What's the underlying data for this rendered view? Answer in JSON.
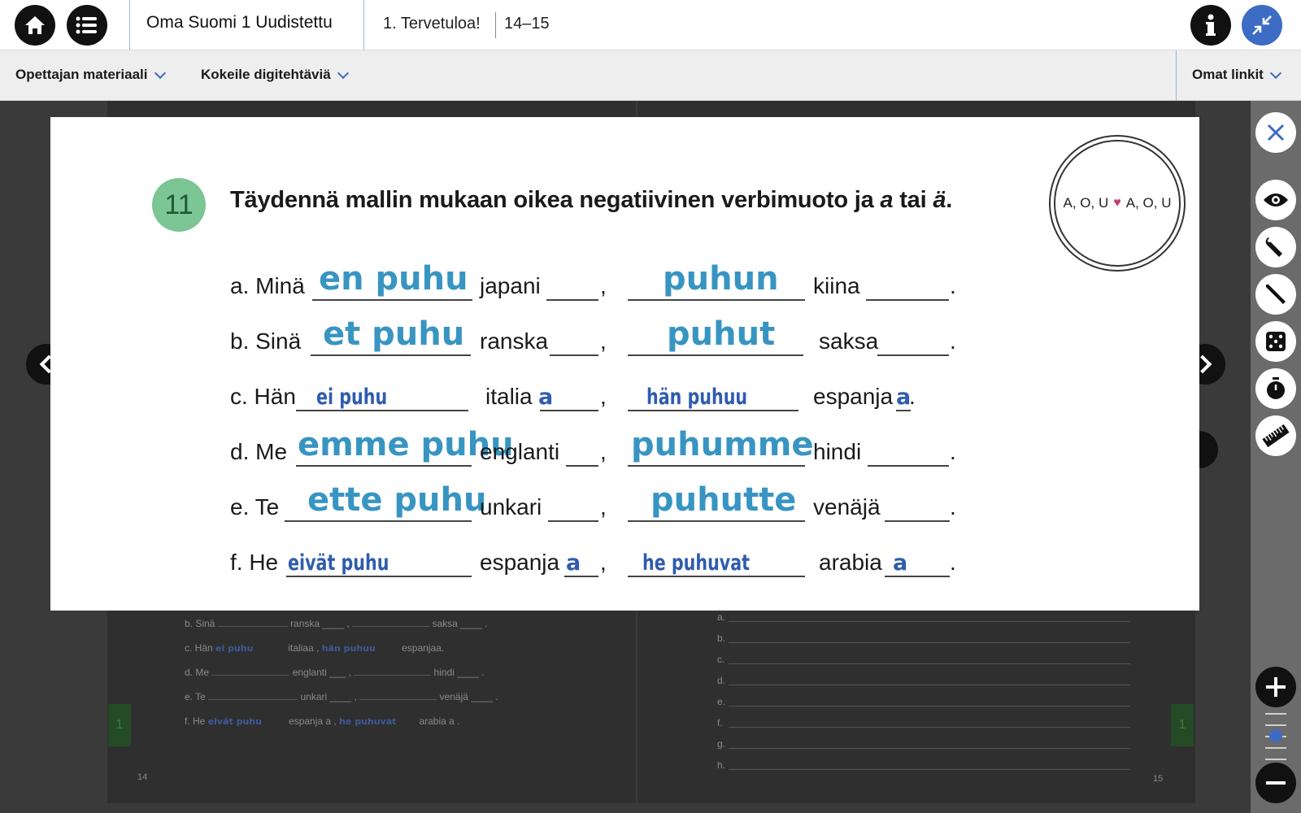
{
  "topbar": {
    "home_icon": "home-icon",
    "toc_icon": "list-icon",
    "book_title": "Oma Suomi 1 Uudistettu",
    "chapter": "1. Tervetuloa!",
    "pages": "14–15",
    "info_icon": "info-icon",
    "collapse_icon": "collapse-icon"
  },
  "subbar": {
    "teacher_material": "Opettajan materiaali",
    "try_digital": "Kokeile digitehtäviä",
    "own_links": "Omat linkit"
  },
  "exercise": {
    "number": "11",
    "instruction_pre": "Täydennä mallin mukaan oikea negatiivinen verbimuoto ja ",
    "instruction_a": "a",
    "instruction_mid": " tai ",
    "instruction_ae": "ä",
    "instruction_end": ".",
    "badge_left": "A, O, U",
    "badge_right": "A, O, U",
    "rows": [
      {
        "subject": "a. Minä",
        "answer1": "en puhu",
        "lang1": "japani",
        "answer2": "puhun",
        "lang2": "kiina",
        "end1": "",
        "end2": ""
      },
      {
        "subject": "b. Sinä",
        "answer1": "et puhu",
        "lang1": "ranska",
        "answer2": "puhut",
        "lang2": "saksa",
        "end1": "",
        "end2": ""
      },
      {
        "subject": "c. Hän",
        "answer1": "ei puhu",
        "lang1": "italia",
        "answer2": "hän  puhuu",
        "lang2": "espanja",
        "end1": "a",
        "end2": "a"
      },
      {
        "subject": "d. Me",
        "answer1": "emme puhu",
        "lang1": "englanti",
        "answer2": "puhumme",
        "lang2": "hindi",
        "end1": "",
        "end2": ""
      },
      {
        "subject": "e. Te",
        "answer1": "ette puhu",
        "lang1": "unkari",
        "answer2": "puhutte",
        "lang2": "venäjä",
        "end1": "",
        "end2": ""
      },
      {
        "subject": "f. He",
        "answer1": "eivät puhu",
        "lang1": "espanja",
        "answer2": "he puhuvat",
        "lang2": "arabia",
        "end1": "a",
        "end2": "a"
      }
    ]
  },
  "background_page": {
    "rows": [
      {
        "subject": "b. Sinä",
        "lang1": "ranska",
        "answer1": "",
        "answer2": "",
        "lang2": "saksa"
      },
      {
        "subject": "c. Hän",
        "lang1": "italiaa",
        "answer1": "ei puhu",
        "answer2": "hän  puhuu",
        "lang2": "espanjaa."
      },
      {
        "subject": "d. Me",
        "lang1": "englanti",
        "answer1": "",
        "answer2": "",
        "lang2": "hindi"
      },
      {
        "subject": "e. Te",
        "lang1": "unkari",
        "answer1": "",
        "answer2": "",
        "lang2": "venäjä"
      },
      {
        "subject": "f. He",
        "lang1": "espanja a",
        "answer1": "eivät puhu",
        "answer2": "he puhuvat",
        "lang2": "arabia  a"
      }
    ],
    "right_letters": [
      "a.",
      "b.",
      "c.",
      "d.",
      "e.",
      "f.",
      "g.",
      "h."
    ],
    "page_left": "14",
    "page_right": "15",
    "tab_left": "1",
    "tab_right": "1"
  },
  "tools": [
    "close-icon",
    "eye-icon",
    "wrench-icon",
    "pen-icon",
    "dice-icon",
    "stopwatch-icon",
    "ruler-icon"
  ],
  "colors": {
    "accent_blue": "#3d6cc4",
    "handwriting_light": "#3895c2",
    "handwriting_dark": "#2f5cae",
    "exercise_badge": "#7cc594"
  }
}
